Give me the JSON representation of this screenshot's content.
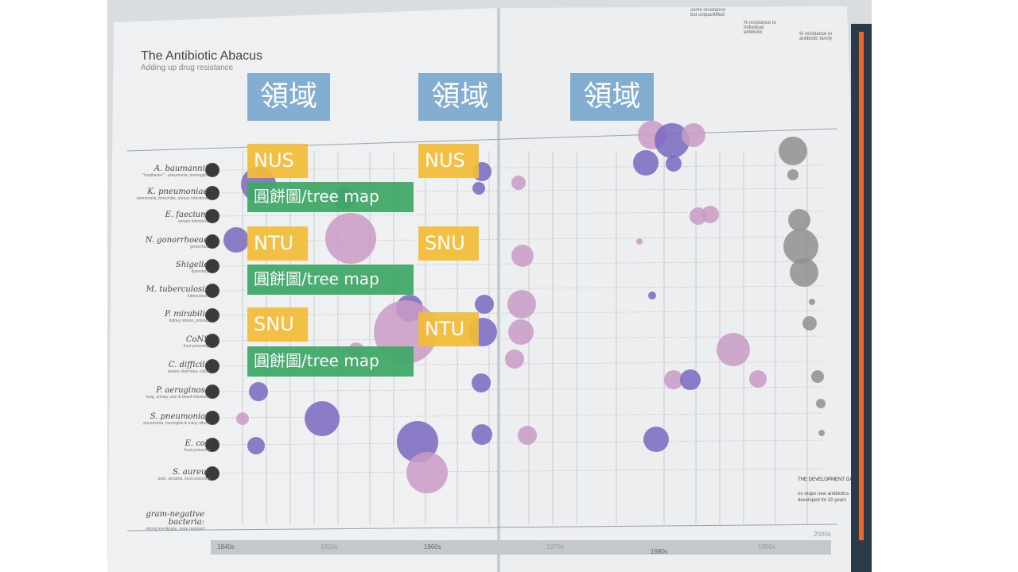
{
  "book": {
    "title": "The Antibiotic Abacus",
    "subtitle": "Adding up drug resistance",
    "bacteria": [
      {
        "name": "A. baumannii",
        "desc": "\"Iraqibacter\" - pneumonia, meningitis"
      },
      {
        "name": "K. pneumoniae",
        "desc": "pneumonia, bronchitis, urinary infections"
      },
      {
        "name": "E. faecium",
        "desc": "urinary infections"
      },
      {
        "name": "N. gonorrhoeae",
        "desc": "gonorrhea"
      },
      {
        "name": "Shigella",
        "desc": "dysentery"
      },
      {
        "name": "M. tuberculosis",
        "desc": "tuberculosis"
      },
      {
        "name": "P. mirabilis",
        "desc": "kidney stones, proteus"
      },
      {
        "name": "CoNS",
        "desc": "food poisoning"
      },
      {
        "name": "C. difficile",
        "desc": "severe diarrhoea, colitis"
      },
      {
        "name": "P. aeruginosa",
        "desc": "lung, urinary, skin & blood infections"
      },
      {
        "name": "S. pneumoniae",
        "desc": "pneumonia, meningitis & many others"
      },
      {
        "name": "E. coli",
        "desc": "food poisoning"
      },
      {
        "name": "S. aureus",
        "desc": "boils, sinusitis, food poisoning"
      }
    ],
    "gram_negative": {
      "name": "gram-negative bacteria:",
      "desc": "strong membrane, more resistant"
    },
    "decades": [
      "1940s",
      "1950s",
      "1960s",
      "1970s",
      "1980s",
      "1990s",
      "2000s"
    ],
    "development_gap": {
      "title": "THE DEVELOPMENT GAP",
      "text": "no major new antibiotics developed for 20 years"
    },
    "legend": [
      "some resistance but unquantified",
      "% resistance to individual antibiotic",
      "% resistance to antibiotic family"
    ]
  },
  "overlays": {
    "field_label": "領域",
    "pie_tree_label": "圓餅圖/tree map",
    "col1": [
      "NUS",
      "NTU",
      "SNU"
    ],
    "col2": [
      "NUS",
      "SNU",
      "NTU"
    ]
  },
  "colors": {
    "purple": "#7a67c0",
    "pink": "#c99bc5",
    "grey": "#8f8f8f",
    "blue_box": "#7ba9cf",
    "yellow_box": "#f2bd37",
    "green_box": "#3ea866"
  }
}
